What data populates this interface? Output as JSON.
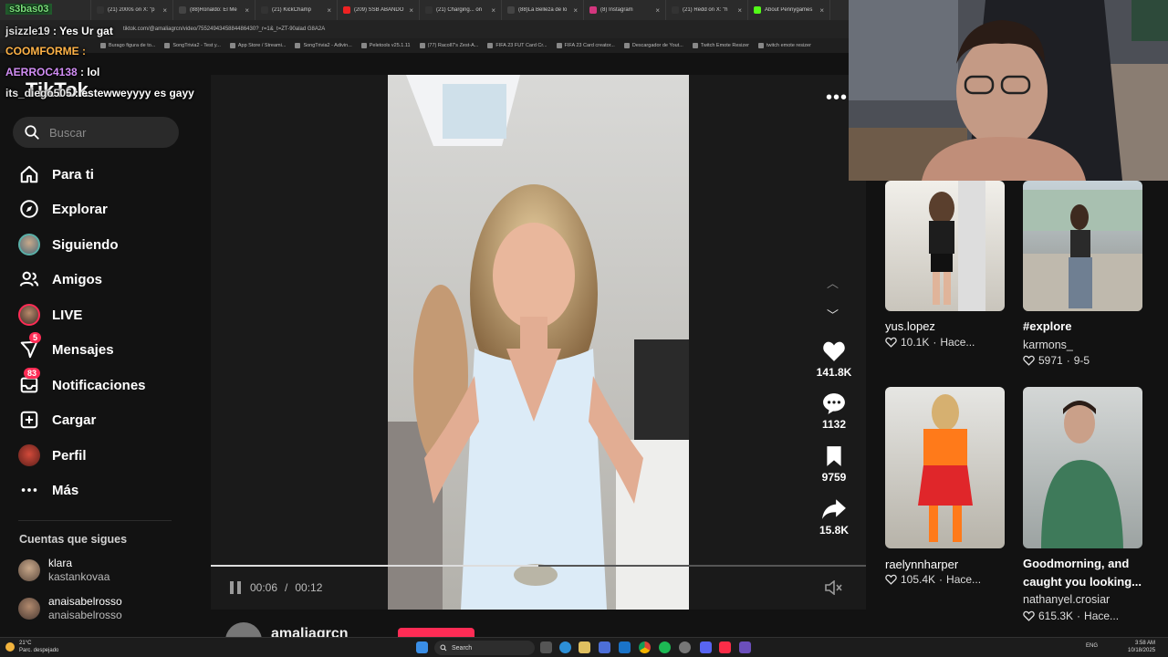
{
  "browser": {
    "tabs": [
      {
        "label": "(21) 2000s on X: \"p",
        "color": "#333"
      },
      {
        "label": "(88)Ronaldo: El Me",
        "color": "#444"
      },
      {
        "label": "(21) KickChamp",
        "color": "#333"
      },
      {
        "label": "(209) SSB ABANDO",
        "color": "#e22"
      },
      {
        "label": "(21) Charging... on",
        "color": "#333"
      },
      {
        "label": "(88)La Belleza de lo",
        "color": "#444"
      },
      {
        "label": "(8) Instagram",
        "color": "#d3367e"
      },
      {
        "label": "(21) Redd on X: \"h",
        "color": "#333"
      },
      {
        "label": "About Pennygames",
        "color": "#53fc18"
      }
    ],
    "url": "tiktok.com/@amaliagrcn/video/7552494345884486430?_r=1&_t=ZT-90alad G8A2A",
    "bookmarks": [
      "Burago figura de to...",
      "SongTrivia2 - Test y...",
      "App Store / Streami...",
      "SongTrivia2 - Adivin...",
      "Peletools v25.1.11",
      "(77) Racoll7's Zest-A...",
      "FIFA 23 FUT Card Cr...",
      "FIFA 23 Card creator...",
      "Descargador de Yout...",
      "Twitch Emote Resizer",
      "twitch emote resizer"
    ]
  },
  "chat": [
    {
      "user": "s3bas03",
      "message": ""
    },
    {
      "user": "jsizzle19",
      "message": "Yes Ur gat"
    },
    {
      "user": "COOMFORME",
      "message": ""
    },
    {
      "user": "AERROC4138",
      "message": "lol"
    },
    {
      "user": "its_diego505",
      "message": "estewweyyyy es gayy"
    }
  ],
  "sidebar": {
    "logo": "TikTok",
    "search_placeholder": "Buscar",
    "items": [
      {
        "label": "Para ti",
        "icon": "home-icon"
      },
      {
        "label": "Explorar",
        "icon": "compass-icon"
      },
      {
        "label": "Siguiendo",
        "icon": "following-avatar-icon"
      },
      {
        "label": "Amigos",
        "icon": "friends-icon"
      },
      {
        "label": "LIVE",
        "icon": "live-icon"
      },
      {
        "label": "Mensajes",
        "icon": "messages-icon",
        "badge": "5"
      },
      {
        "label": "Notificaciones",
        "icon": "inbox-icon",
        "badge": "83"
      },
      {
        "label": "Cargar",
        "icon": "upload-icon"
      },
      {
        "label": "Perfil",
        "icon": "profile-icon"
      },
      {
        "label": "Más",
        "icon": "more-icon"
      }
    ],
    "following_title": "Cuentas que sigues",
    "following": [
      {
        "name": "klara",
        "username": "kastankovaa"
      },
      {
        "name": "anaisabelrosso",
        "username": "anaisabelrosso"
      }
    ]
  },
  "video": {
    "time_current": "00:06",
    "time_total": "00:12",
    "progress_fraction": 0.5,
    "author": "amaliagrcn",
    "likes": "141.8K",
    "comments": "1132",
    "saves": "9759",
    "shares": "15.8K"
  },
  "recommended": [
    {
      "title": "yus.lopez",
      "subtitle": "",
      "likes": "10.1K",
      "date": "Hace..."
    },
    {
      "title": "#explore",
      "subtitle": "karmons_",
      "likes": "5971",
      "date": "9-5"
    },
    {
      "title": "raelynnharper",
      "subtitle": "",
      "likes": "105.4K",
      "date": "Hace..."
    },
    {
      "title": "Goodmorning, and caught you looking...",
      "subtitle": "nathanyel.crosiar",
      "likes": "615.3K",
      "date": "Hace..."
    }
  ],
  "taskbar": {
    "weather_temp": "21°C",
    "weather_desc": "Parc. despejado",
    "search_label": "Search",
    "lang": "ENG",
    "time": "3:58 AM",
    "date": "10/18/2025"
  },
  "colors": {
    "accent": "#fe2c55",
    "background": "#121212"
  }
}
